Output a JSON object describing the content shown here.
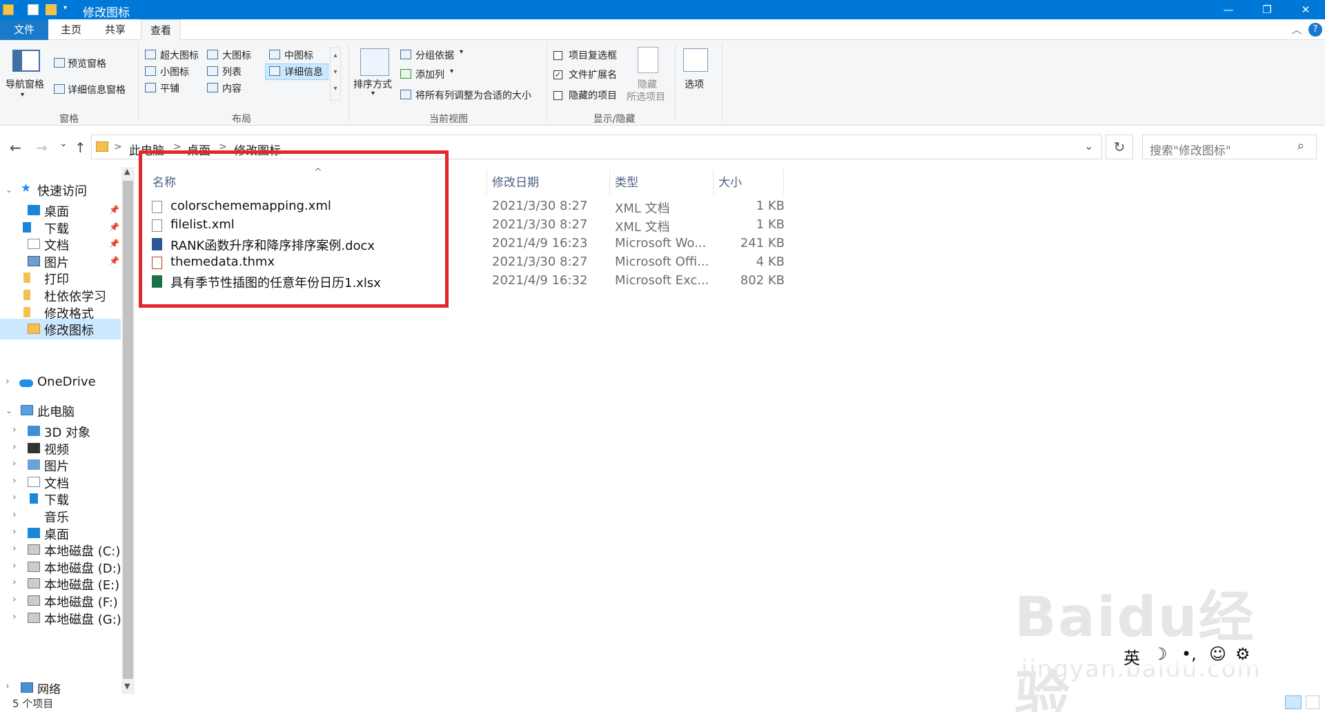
{
  "window": {
    "title": "修改图标",
    "controls": {
      "minimize": "—",
      "maximize": "❐",
      "close": "✕"
    }
  },
  "tabs": {
    "file": "文件",
    "home": "主页",
    "share": "共享",
    "view": "查看",
    "collapse": "︿",
    "help": "?"
  },
  "ribbon": {
    "panes": {
      "nav_pane": "导航窗格",
      "preview_pane": "预览窗格",
      "details_pane": "详细信息窗格",
      "group": "窗格"
    },
    "layout": {
      "extra_large": "超大图标",
      "large": "大图标",
      "medium": "中图标",
      "small": "小图标",
      "list": "列表",
      "details": "详细信息",
      "tiles": "平铺",
      "content": "内容",
      "group": "布局"
    },
    "current_view": {
      "sort_by": "排序方式",
      "group_by": "分组依据",
      "add_columns": "添加列",
      "size_all_columns": "将所有列调整为合适的大小",
      "group": "当前视图"
    },
    "show_hide": {
      "item_checkboxes": "项目复选框",
      "item_checkboxes_checked": false,
      "file_extensions": "文件扩展名",
      "file_extensions_checked": true,
      "hidden_items": "隐藏的项目",
      "hidden_items_checked": false,
      "hide_selected_1": "隐藏",
      "hide_selected_2": "所选项目",
      "group": "显示/隐藏"
    },
    "options": "选项"
  },
  "address": {
    "back": "←",
    "forward": "→",
    "recent": "⌄",
    "up": "↑",
    "crumbs": [
      "此电脑",
      "桌面",
      "修改图标"
    ],
    "separator": ">",
    "dropdown": "⌄",
    "refresh": "↻",
    "search_placeholder": "搜索\"修改图标\"",
    "search_icon": "⌕"
  },
  "nav": {
    "quick_access": "快速访问",
    "items": [
      {
        "label": "桌面",
        "pinned": true
      },
      {
        "label": "下载",
        "pinned": true
      },
      {
        "label": "文档",
        "pinned": true
      },
      {
        "label": "图片",
        "pinned": true
      },
      {
        "label": "打印",
        "pinned": false
      },
      {
        "label": "杜依依学习",
        "pinned": false
      },
      {
        "label": "修改格式",
        "pinned": false
      },
      {
        "label": "修改图标",
        "pinned": false
      }
    ],
    "onedrive": "OneDrive",
    "this_pc": "此电脑",
    "pc_items": [
      "3D 对象",
      "视频",
      "图片",
      "文档",
      "下载",
      "音乐",
      "桌面",
      "本地磁盘 (C:)",
      "本地磁盘 (D:)",
      "本地磁盘 (E:)",
      "本地磁盘 (F:)",
      "本地磁盘 (G:)"
    ],
    "network": "网络",
    "pin_glyph": "📌"
  },
  "columns": {
    "name": "名称",
    "date": "修改日期",
    "type": "类型",
    "size": "大小",
    "sort_glyph": "^"
  },
  "files": [
    {
      "name": "colorschememapping.xml",
      "date": "2021/3/30 8:27",
      "type": "XML 文档",
      "size": "1 KB",
      "icon": "xml-file-icon"
    },
    {
      "name": "filelist.xml",
      "date": "2021/3/30 8:27",
      "type": "XML 文档",
      "size": "1 KB",
      "icon": "xml-file-icon"
    },
    {
      "name": "RANK函数升序和降序排序案例.docx",
      "date": "2021/4/9 16:23",
      "type": "Microsoft Wo...",
      "size": "241 KB",
      "icon": "word-file-icon"
    },
    {
      "name": "themedata.thmx",
      "date": "2021/3/30 8:27",
      "type": "Microsoft Offi...",
      "size": "4 KB",
      "icon": "office-theme-icon"
    },
    {
      "name": "具有季节性插图的任意年份日历1.xlsx",
      "date": "2021/4/9 16:32",
      "type": "Microsoft Exc...",
      "size": "802 KB",
      "icon": "excel-file-icon"
    }
  ],
  "status": {
    "count": "5 个项目"
  },
  "watermark": {
    "brand": "Baidu经验",
    "url": "jingyan.baidu.com"
  },
  "ime": {
    "lang": "英",
    "moon": "☽",
    "punct": "•,",
    "emoji": "☺",
    "settings": "⚙"
  },
  "colors": {
    "accent": "#0078d7",
    "highlight_box": "#e3262b",
    "selection": "#cce8ff"
  }
}
